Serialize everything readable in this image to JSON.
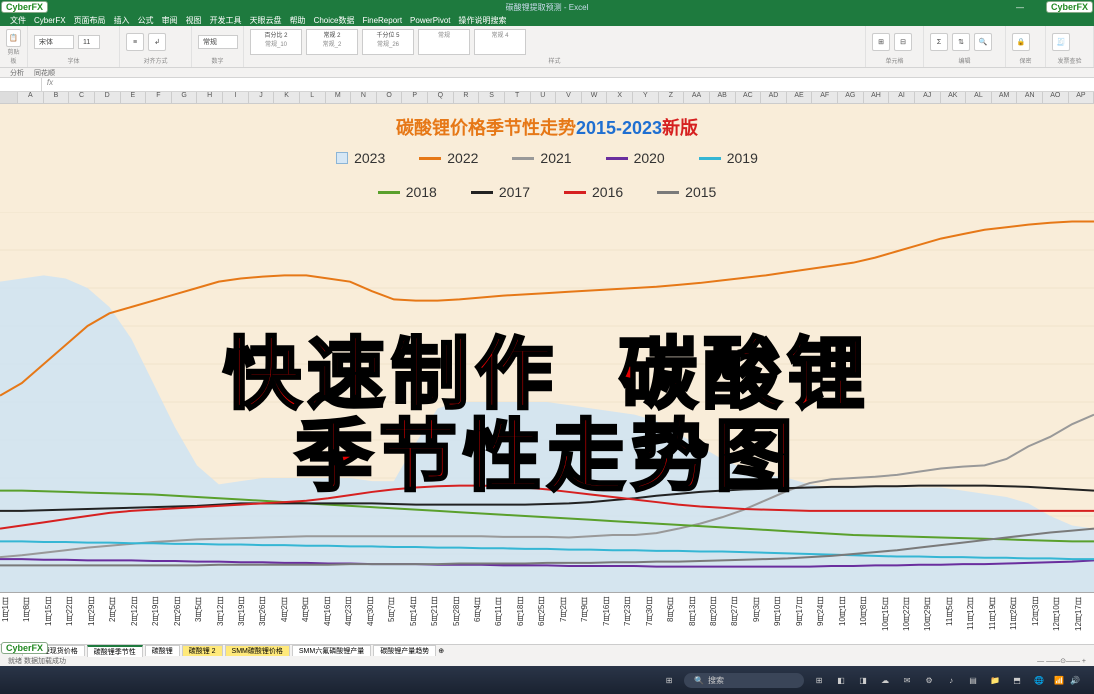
{
  "brand": "CyberFX",
  "window": {
    "title": "碳酸锂提取预测 - Excel"
  },
  "menu": [
    "文件",
    "CyberFX",
    "页面布局",
    "插入",
    "公式",
    "审阅",
    "视图",
    "开发工具",
    "天眼云盘",
    "帮助",
    "Choice数据",
    "FineReport",
    "PowerPivot",
    "操作说明搜索"
  ],
  "qat": [
    "分析",
    "同花顺"
  ],
  "ribbon": {
    "styles": [
      {
        "name": "百分比 2",
        "v": "常规_10"
      },
      {
        "name": "常规 2",
        "v": "常规_2"
      },
      {
        "name": "千分位 5",
        "v": "常规_26"
      },
      {
        "name": "",
        "v": "常规"
      },
      {
        "name": "",
        "v": "常规 4"
      }
    ],
    "groups": [
      "剪贴板",
      "字体",
      "对齐方式",
      "数字",
      "样式",
      "单元格",
      "编辑",
      "保密",
      "发票查验"
    ]
  },
  "formula": {
    "namebox": "",
    "fx": "fx"
  },
  "columns": [
    "A",
    "B",
    "C",
    "D",
    "E",
    "F",
    "G",
    "H",
    "I",
    "J",
    "K",
    "L",
    "M",
    "N",
    "O",
    "P",
    "Q",
    "R",
    "S",
    "T",
    "U",
    "V",
    "W",
    "X",
    "Y",
    "Z",
    "AA",
    "AB",
    "AC",
    "AD",
    "AE",
    "AF",
    "AG",
    "AH",
    "AI",
    "AJ",
    "AK",
    "AL",
    "AM",
    "AN",
    "AO",
    "AP"
  ],
  "sheets": [
    "碳酸锂现货价格",
    "碳酸锂季节性",
    "碳酸锂",
    "碳酸锂 2",
    "SMM碳酸锂价格",
    "SMM六氟磷酸锂产量",
    "碳酸锂产量趋势"
  ],
  "status": "就绪 数据加载成功",
  "tb": {
    "search": "搜索",
    "time": "",
    "icons": [
      "⊞",
      "◧",
      "◨",
      "☁",
      "✉",
      "⚙",
      "♪",
      "▤",
      "📁",
      "⬒",
      "🌐"
    ]
  },
  "overlay": {
    "a": "快速制作",
    "b": "碳酸锂",
    "c": "季节性走势图"
  },
  "chart_data": {
    "type": "line",
    "title_parts": [
      "碳酸锂价格季节性走势",
      "2015-2023",
      "新版"
    ],
    "x": [
      "1月1日",
      "1月8日",
      "1月15日",
      "1月22日",
      "1月29日",
      "2月5日",
      "2月12日",
      "2月19日",
      "2月26日",
      "3月5日",
      "3月12日",
      "3月19日",
      "3月26日",
      "4月2日",
      "4月9日",
      "4月16日",
      "4月23日",
      "4月30日",
      "5月7日",
      "5月14日",
      "5月21日",
      "5月28日",
      "6月4日",
      "6月11日",
      "6月18日",
      "6月25日",
      "7月2日",
      "7月9日",
      "7月16日",
      "7月23日",
      "7月30日",
      "8月6日",
      "8月13日",
      "8月20日",
      "8月27日",
      "9月3日",
      "9月10日",
      "9月17日",
      "9月24日",
      "10月1日",
      "10月8日",
      "10月15日",
      "10月22日",
      "10月29日",
      "11月5日",
      "11月12日",
      "11月19日",
      "11月26日",
      "12月3日",
      "12月10日",
      "12月17日"
    ],
    "legend": [
      {
        "name": "2023",
        "type": "area",
        "color": "#cfe3f2"
      },
      {
        "name": "2022",
        "color": "#e67817"
      },
      {
        "name": "2021",
        "color": "#999999"
      },
      {
        "name": "2020",
        "color": "#6a2e9e"
      },
      {
        "name": "2019",
        "color": "#35b6d4"
      },
      {
        "name": "2018",
        "color": "#5aa02c"
      },
      {
        "name": "2017",
        "color": "#222222"
      },
      {
        "name": "2016",
        "color": "#d62020"
      },
      {
        "name": "2015",
        "color": "#7a7a7a"
      }
    ],
    "ylim": [
      0,
      600
    ],
    "series": [
      {
        "name": "2023",
        "values": [
          490,
          495,
          500,
          495,
          480,
          450,
          400,
          330,
          260,
          200,
          170,
          175,
          180,
          180,
          180,
          180,
          180,
          175,
          175,
          235,
          290,
          300,
          300,
          300,
          300,
          300,
          295,
          290,
          285,
          280,
          270,
          250,
          230,
          210,
          195,
          185,
          180,
          170,
          165,
          165,
          165,
          165,
          165,
          165,
          160,
          155,
          150,
          140,
          120,
          105,
          100
        ]
      },
      {
        "name": "2022",
        "values": [
          310,
          330,
          360,
          390,
          420,
          440,
          450,
          460,
          470,
          480,
          490,
          495,
          498,
          500,
          500,
          495,
          490,
          475,
          462,
          460,
          460,
          462,
          465,
          468,
          470,
          472,
          474,
          476,
          478,
          480,
          482,
          485,
          488,
          492,
          496,
          500,
          505,
          510,
          515,
          520,
          528,
          538,
          548,
          558,
          565,
          572,
          576,
          580,
          583,
          585,
          585
        ]
      },
      {
        "name": "2021",
        "values": [
          55,
          58,
          62,
          66,
          70,
          73,
          76,
          79,
          81,
          83,
          84,
          85,
          86,
          87,
          88,
          88,
          88,
          88,
          88,
          88,
          88,
          88,
          88,
          87,
          87,
          87,
          86,
          88,
          90,
          90,
          93,
          100,
          108,
          118,
          130,
          145,
          160,
          172,
          178,
          180,
          182,
          185,
          190,
          195,
          198,
          200,
          210,
          230,
          245,
          265,
          280
        ]
      },
      {
        "name": "2020",
        "values": [
          52,
          52,
          51,
          51,
          50,
          50,
          50,
          49,
          49,
          48,
          48,
          47,
          47,
          46,
          46,
          45,
          45,
          44,
          44,
          44,
          43,
          43,
          43,
          42,
          42,
          42,
          41,
          41,
          41,
          41,
          40,
          40,
          40,
          40,
          40,
          40,
          40,
          40,
          41,
          41,
          42,
          42,
          43,
          43,
          44,
          44,
          45,
          46,
          47,
          48,
          50
        ]
      },
      {
        "name": "2019",
        "values": [
          80,
          80,
          79,
          79,
          78,
          78,
          77,
          77,
          76,
          76,
          75,
          75,
          74,
          74,
          73,
          73,
          72,
          72,
          71,
          71,
          70,
          70,
          69,
          69,
          68,
          68,
          67,
          67,
          66,
          66,
          65,
          65,
          64,
          64,
          63,
          62,
          61,
          60,
          59,
          58,
          57,
          56,
          56,
          55,
          55,
          54,
          54,
          53,
          53,
          52,
          52
        ]
      },
      {
        "name": "2018",
        "values": [
          160,
          160,
          159,
          158,
          157,
          156,
          155,
          154,
          152,
          150,
          148,
          146,
          144,
          142,
          140,
          138,
          136,
          134,
          132,
          130,
          128,
          126,
          124,
          122,
          120,
          118,
          116,
          114,
          112,
          110,
          108,
          106,
          104,
          102,
          100,
          98,
          96,
          94,
          92,
          90,
          89,
          88,
          87,
          86,
          85,
          84,
          83,
          82,
          81,
          80,
          80
        ]
      },
      {
        "name": "2017",
        "values": [
          128,
          128,
          129,
          130,
          131,
          132,
          133,
          134,
          135,
          136,
          138,
          140,
          140,
          140,
          140,
          140,
          140,
          140,
          139,
          138,
          138,
          138,
          138,
          138,
          138,
          139,
          140,
          142,
          145,
          148,
          152,
          155,
          158,
          160,
          162,
          163,
          164,
          165,
          166,
          166,
          167,
          167,
          168,
          168,
          168,
          168,
          167,
          166,
          164,
          162,
          160
        ]
      },
      {
        "name": "2016",
        "values": [
          100,
          105,
          110,
          115,
          120,
          125,
          128,
          130,
          132,
          134,
          136,
          138,
          140,
          142,
          144,
          148,
          153,
          158,
          162,
          165,
          167,
          168,
          168,
          167,
          165,
          162,
          158,
          154,
          150,
          146,
          142,
          138,
          135,
          133,
          131,
          130,
          129,
          128,
          128,
          128,
          128,
          128,
          128,
          128,
          128,
          128,
          128,
          128,
          128,
          128,
          128
        ]
      },
      {
        "name": "2015",
        "values": [
          42,
          42,
          42,
          42,
          42,
          42,
          42,
          42,
          42,
          42,
          43,
          43,
          43,
          43,
          43,
          43,
          44,
          44,
          44,
          44,
          44,
          45,
          45,
          45,
          45,
          46,
          46,
          46,
          47,
          47,
          48,
          48,
          49,
          50,
          51,
          52,
          53,
          55,
          57,
          60,
          63,
          66,
          70,
          74,
          78,
          82,
          86,
          90,
          94,
          97,
          100
        ]
      }
    ]
  }
}
